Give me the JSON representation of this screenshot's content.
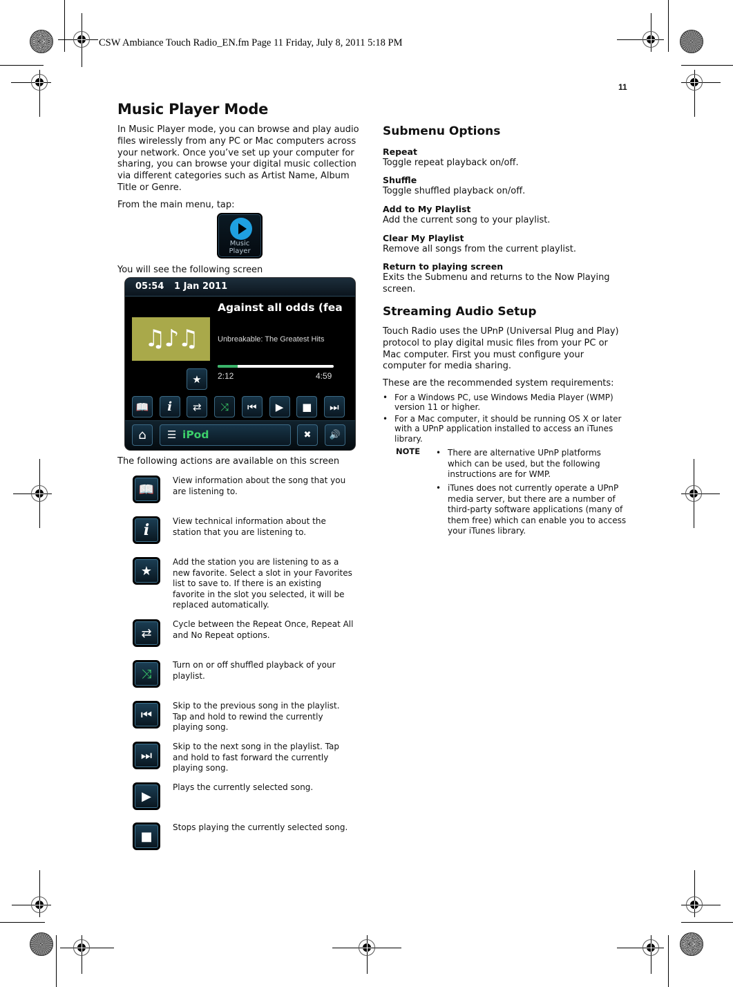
{
  "print_stamp": "CSW Ambiance Touch Radio_EN.fm  Page 11  Friday, July 8, 2011  5:18 PM",
  "page_number": "11",
  "left": {
    "title": "Music Player Mode",
    "intro": "In Music Player mode, you can browse and play audio files wirelessly from any PC or Mac computers across your network. Once you’ve set up your computer for sharing, you can browse your digital music collection via different categories such as Artist Name, Album Title or Genre.",
    "from_menu": "From the main menu, tap:",
    "launcher": {
      "icon": "play-circle-icon",
      "label_line1": "Music",
      "label_line2": "Player"
    },
    "see_screen": "You will see the following screen",
    "screen": {
      "time": "05:54",
      "date": "1 Jan 2011",
      "song_title": "Against all odds (fea",
      "album": "Unbreakable: The Greatest Hits",
      "art_glyphs": "♫♪♫",
      "elapsed": "2:12",
      "total": "4:59",
      "progress_fraction": 0.17,
      "controls": [
        {
          "name": "song-info",
          "glyph": "📖",
          "icon": "book-icon"
        },
        {
          "name": "station-info",
          "glyph": "i",
          "icon": "info-icon"
        },
        {
          "name": "repeat",
          "glyph": "⇄",
          "icon": "repeat-icon"
        },
        {
          "name": "shuffle",
          "glyph": "⤨",
          "icon": "shuffle-icon",
          "active": true
        },
        {
          "name": "previous",
          "glyph": "⏮",
          "icon": "skip-back-icon"
        },
        {
          "name": "play",
          "glyph": "▶",
          "icon": "play-icon"
        },
        {
          "name": "stop",
          "glyph": "■",
          "icon": "stop-icon"
        },
        {
          "name": "next",
          "glyph": "⏭",
          "icon": "skip-forward-icon"
        }
      ],
      "favorite_glyph": "★",
      "home_glyph": "⌂",
      "menu_glyph": "☰",
      "source": "iPod",
      "close_glyph": "✖",
      "volume_glyph": "🔊"
    },
    "actions_intro": "The following actions are available on this screen",
    "actions": [
      {
        "icon": "book-icon",
        "glyph": "📖",
        "text": "View information about the song that you are listening to."
      },
      {
        "icon": "info-icon",
        "glyph": "i",
        "text": "View technical information about the station that you are listening to."
      },
      {
        "icon": "favorite-add-icon",
        "glyph": "★",
        "text": "Add the station you are listening to as a new favorite. Select a slot in your Favorites list to save to. If there is an existing favorite in the slot you selected, it will be replaced automatically."
      },
      {
        "icon": "repeat-icon",
        "glyph": "⇄",
        "text": "Cycle between the Repeat Once, Repeat All and No Repeat options."
      },
      {
        "icon": "shuffle-icon",
        "glyph": "⤨",
        "text": "Turn on or off shuffled playback of your playlist."
      },
      {
        "icon": "skip-back-icon",
        "glyph": "⏮",
        "text": "Skip to the previous song in the playlist. Tap and hold to rewind the currently playing song."
      },
      {
        "icon": "skip-forward-icon",
        "glyph": "⏭",
        "text": "Skip to the next song in the playlist. Tap and hold to fast forward the currently playing song."
      },
      {
        "icon": "play-icon",
        "glyph": "▶",
        "text": "Plays the currently selected song."
      },
      {
        "icon": "stop-icon",
        "glyph": "■",
        "text": "Stops playing the currently selected song."
      }
    ]
  },
  "right": {
    "submenu_title": "Submenu Options",
    "options": [
      {
        "title": "Repeat",
        "desc": "Toggle repeat playback on/off."
      },
      {
        "title": "Shuffle",
        "desc": "Toggle shuffled playback on/off."
      },
      {
        "title": "Add to My Playlist",
        "desc": "Add the current song to your playlist."
      },
      {
        "title": "Clear My Playlist",
        "desc": "Remove all songs from the current playlist."
      },
      {
        "title": "Return to playing screen",
        "desc": "Exits the Submenu and returns to the Now Playing screen."
      }
    ],
    "streaming_title": "Streaming Audio Setup",
    "streaming_intro": "Touch Radio uses the UPnP (Universal Plug and Play) protocol to play digital music files from your PC or Mac computer. First you must configure your computer for media sharing.",
    "requirements_intro": "These are the recommended system requirements:",
    "requirements": [
      "For a Windows PC, use Windows Media Player (WMP) version  11 or higher.",
      "For a Mac computer, it should be running OS X or later with a UPnP application installed to access an iTunes library."
    ],
    "note_label": "NOTE",
    "notes": [
      "There are alternative UPnP platforms which can be used, but the following instructions are for WMP.",
      "iTunes does not currently operate a UPnP media server, but there are a number of third-party software applications (many of them free) which can enable you to access your iTunes library."
    ],
    "bullet": "•"
  }
}
